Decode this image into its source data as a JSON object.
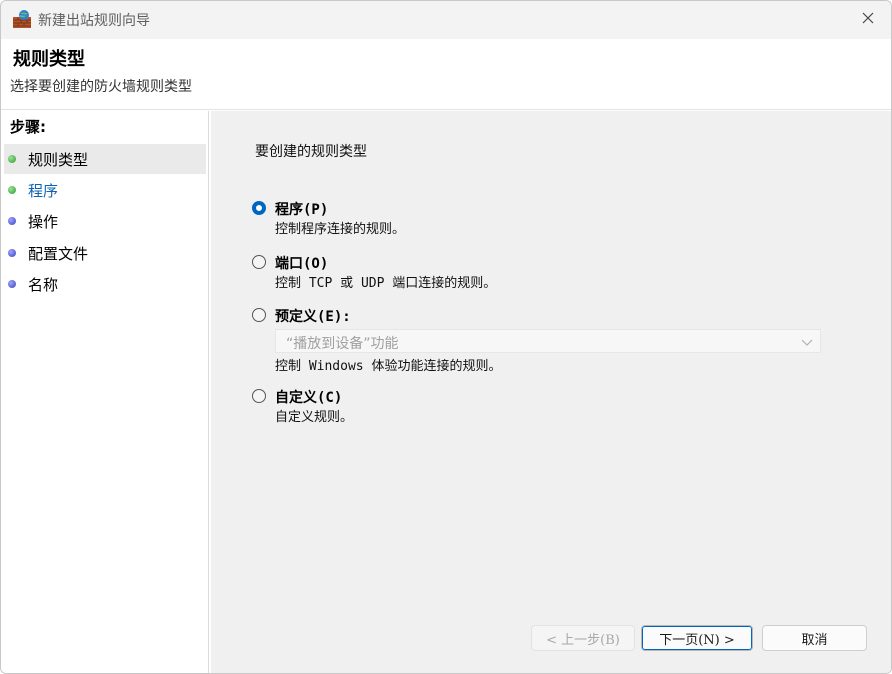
{
  "window": {
    "title": "新建出站规则向导"
  },
  "header": {
    "title": "规则类型",
    "subtitle": "选择要创建的防火墙规则类型"
  },
  "steps": {
    "heading": "步骤:",
    "items": [
      {
        "label": "规则类型",
        "status": "green"
      },
      {
        "label": "程序",
        "status": "green"
      },
      {
        "label": "操作",
        "status": "blue"
      },
      {
        "label": "配置文件",
        "status": "blue"
      },
      {
        "label": "名称",
        "status": "blue"
      }
    ]
  },
  "main": {
    "prompt": "要创建的规则类型",
    "options": [
      {
        "label": "程序(P)",
        "description": "控制程序连接的规则。",
        "selected": true
      },
      {
        "label": "端口(O)",
        "description": "控制 TCP 或 UDP 端口连接的规则。",
        "selected": false
      },
      {
        "label": "预定义(E):",
        "selected": false
      },
      {
        "label": "自定义(C)",
        "description": "自定义规则。",
        "selected": false
      }
    ],
    "predefined_dropdown": {
      "value": "“播放到设备”功能",
      "enabled": false
    },
    "predefined_description": "控制 Windows 体验功能连接的规则。"
  },
  "buttons": {
    "back": "< 上一步(B)",
    "next": "下一页(N) >",
    "cancel": "取消"
  },
  "colors": {
    "accent": "#0067c0",
    "link": "#0b63b6",
    "content_bg": "#f0f0f0"
  },
  "icons": {
    "app": "firewall-wizard-icon",
    "close": "close-icon",
    "dropdown": "chevron-down-icon"
  }
}
